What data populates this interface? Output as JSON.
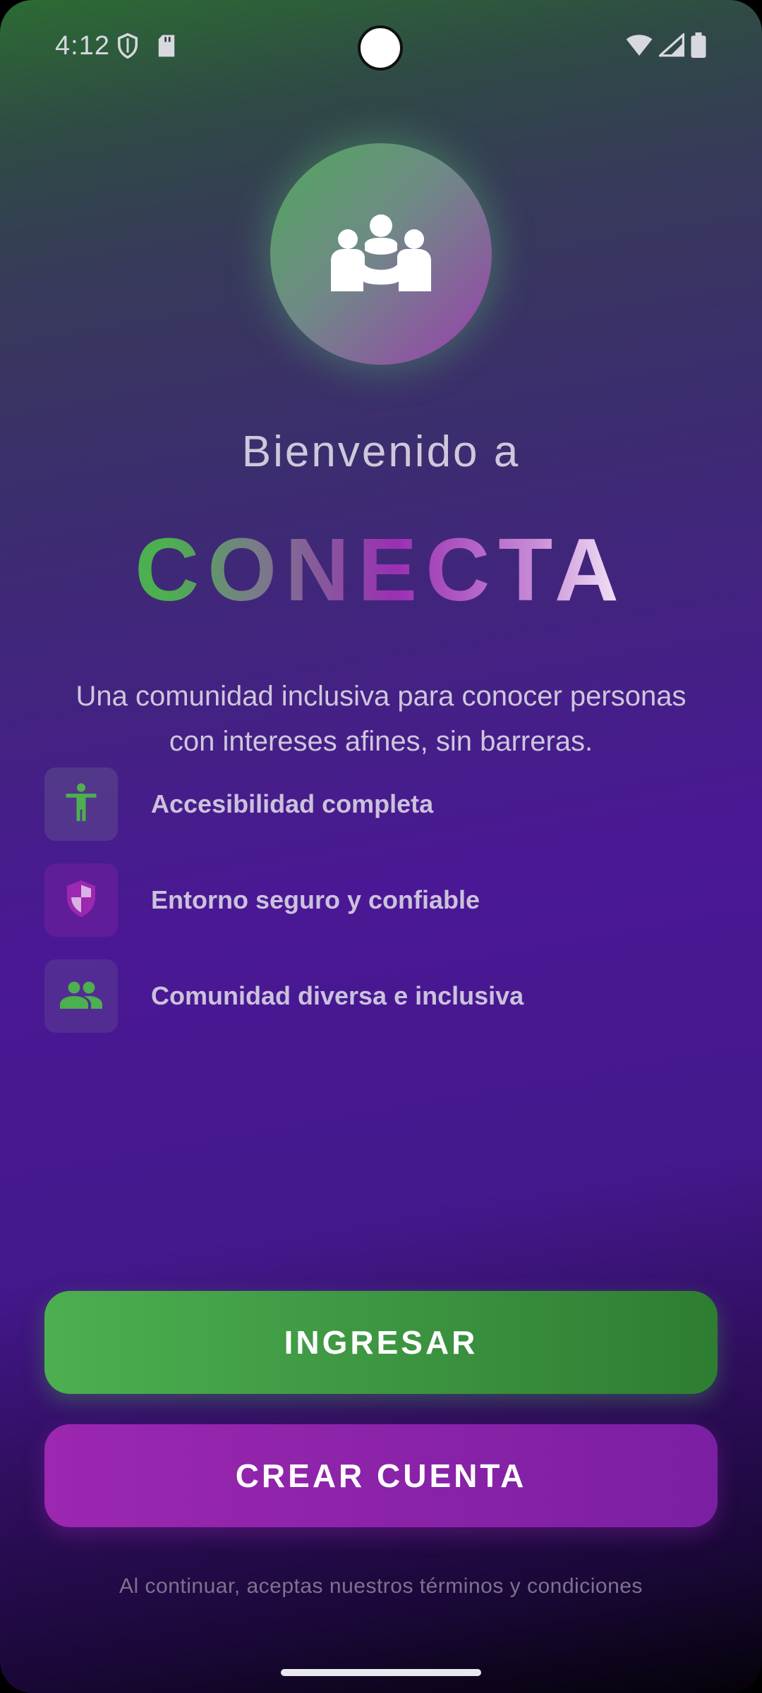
{
  "status_bar": {
    "time": "4:12",
    "left_icons": [
      "shield-icon",
      "sd-card-icon"
    ],
    "right_icons": [
      "wifi-icon",
      "signal-icon",
      "battery-icon"
    ]
  },
  "logo": {
    "icon": "community-group-icon",
    "glow_color": "#4caf50"
  },
  "welcome_text": "Bienvenido a",
  "brand_name": "CONECTA",
  "tagline": "Una comunidad inclusiva para conocer personas con intereses afines, sin barreras.",
  "features": [
    {
      "icon": "accessibility-icon",
      "label": "Accesibilidad completa",
      "accent": "#4caf50"
    },
    {
      "icon": "security-shield-icon",
      "label": "Entorno seguro y confiable",
      "accent": "#9c27b0"
    },
    {
      "icon": "people-icon",
      "label": "Comunidad diversa e inclusiva",
      "accent": "#4caf50"
    }
  ],
  "buttons": {
    "login_label": "INGRESAR",
    "register_label": "CREAR CUENTA"
  },
  "terms_text": "Al continuar, aceptas nuestros términos y condiciones",
  "colors": {
    "primary_green": "#4caf50",
    "primary_purple": "#9c27b0",
    "background_top": "#2c6b33",
    "background_mid": "#4a1894",
    "background_bottom": "#050209"
  }
}
